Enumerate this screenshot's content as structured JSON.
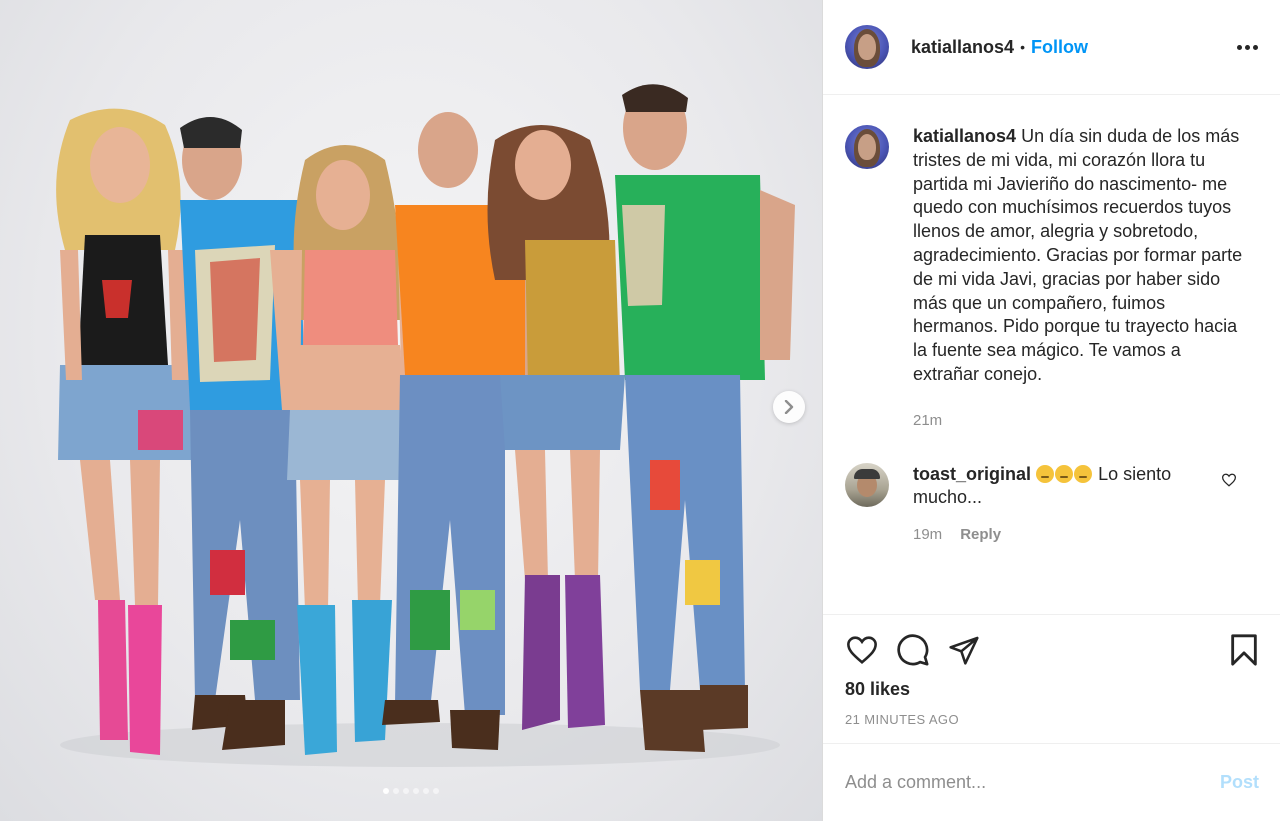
{
  "post": {
    "username": "katiallanos4",
    "follow_label": "Follow",
    "separator": "•",
    "caption": "Un día sin duda de los más tristes de mi vida, mi corazón llora tu partida mi Javieriño do nascimento- me quedo con muchísimos recuerdos tuyos llenos de amor, alegria y sobretodo, agradecimiento. Gracias por formar parte de mi vida Javi, gracias por haber sido más que un compañero, fuimos hermanos. Pido porque tu trayecto hacia la fuente sea mágico. Te vamos a extrañar conejo.",
    "caption_time": "21m",
    "likes": "80 likes",
    "timestamp": "21 MINUTES AGO",
    "carousel": {
      "total": 6,
      "active": 1
    }
  },
  "comments": [
    {
      "username": "toast_original",
      "emojis": [
        "slightly-frowning-face",
        "pensive-face",
        "crying-face"
      ],
      "text": "Lo siento mucho...",
      "time": "19m",
      "reply_label": "Reply"
    }
  ],
  "composer": {
    "placeholder": "Add a comment...",
    "post_label": "Post"
  },
  "icons": {
    "like": "heart-icon",
    "comment": "comment-bubble-icon",
    "share": "paper-plane-icon",
    "save": "bookmark-icon",
    "next": "chevron-right-icon",
    "more": "more-dots-icon"
  },
  "colors": {
    "accent": "#0095f6",
    "post_disabled": "#b2dffc",
    "muted_text": "#8e8e8e",
    "border": "#dbdbdb"
  }
}
